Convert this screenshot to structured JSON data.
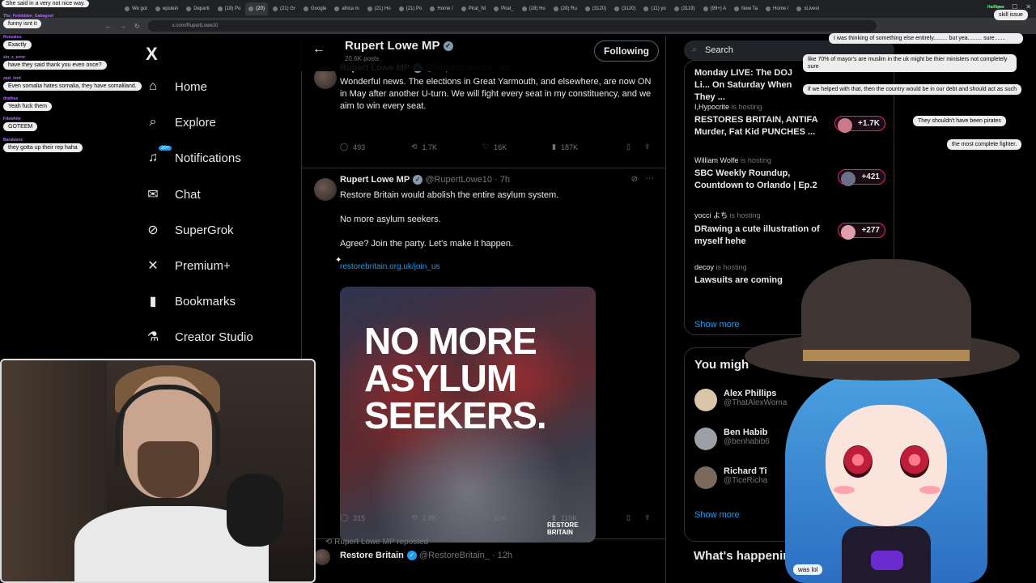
{
  "browser": {
    "tabs": [
      "We got",
      "epstein",
      "Departi",
      "(18) Po",
      "(20)",
      "(21) Gr",
      "Google",
      "africa m",
      "(21) Ho",
      "(21) Po",
      "Home /",
      "Pirat_Ni",
      "Pirat_",
      "(28) Ho",
      "(28) Ru",
      "(3120)",
      "(3120)",
      "(11) yo",
      "(3119)",
      "(99+) A",
      "New Ta",
      "Home /",
      "xLivest"
    ],
    "url": "x.com/RupertLowe10"
  },
  "nav": {
    "logo": "X",
    "items": [
      {
        "label": "Home",
        "icon": "home-icon"
      },
      {
        "label": "Explore",
        "icon": "search-icon"
      },
      {
        "label": "Notifications",
        "icon": "bell-icon",
        "badge": "20+"
      },
      {
        "label": "Chat",
        "icon": "mail-icon"
      },
      {
        "label": "SuperGrok",
        "icon": "grok-icon"
      },
      {
        "label": "Premium+",
        "icon": "x-icon"
      },
      {
        "label": "Bookmarks",
        "icon": "bookmark-icon"
      },
      {
        "label": "Creator Studio",
        "icon": "flask-icon"
      }
    ]
  },
  "profile": {
    "name": "Rupert Lowe MP",
    "posts": "20.6K posts",
    "follow_label": "Following"
  },
  "tweets": [
    {
      "name": "Rupert Lowe MP",
      "handle": "@RupertLowe10 · 5h",
      "text": "Wonderful news. The elections in Great Yarmouth, and elsewhere, are now ON in May after another U-turn. We will fight every seat in my constituency, and we aim to win every seat.",
      "replies": "493",
      "reposts": "1.7K",
      "likes": "16K",
      "views": "187K"
    },
    {
      "name": "Rupert Lowe MP",
      "handle": "@RupertLowe10 · 7h",
      "line1": "Restore Britain would abolish the entire asylum system.",
      "line2": "No more asylum seekers.",
      "line3": "Agree? Join the party. Let's make it happen.",
      "link": "restorebritain.org.uk/join_us",
      "media_text": "NO MORE ASYLUM SEEKERS.",
      "media_brand": "RESTORE BRITAIN",
      "replies": "315",
      "reposts": "1.8K",
      "likes": "10K",
      "views": "119K"
    }
  ],
  "repost": {
    "label": "Rupert Lowe MP reposted",
    "name": "Restore Britain",
    "handle": "@RestoreBritain_ · 12h"
  },
  "sidebar": {
    "search_placeholder": "Search",
    "top_item": "Monday LIVE: The DOJ Li... On Saturday When They ...",
    "spaces": [
      {
        "host": "I,Hypocrite",
        "meta": "is hosting",
        "title": "RESTORES BRITAIN, ANTIFA Murder, Fat Kid PUNCHES ...",
        "count": "+1.7K"
      },
      {
        "host": "William Wolfe",
        "meta": "is hosting",
        "title": "SBC Weekly Roundup, Countdown to Orlando | Ep.2",
        "count": "+421"
      },
      {
        "host": "yocci よち",
        "meta": "is hosting",
        "title": "DRawing a cute illustration of myself hehe",
        "count": "+277"
      },
      {
        "host": "decoy",
        "meta": "is hosting",
        "title": "Lawsuits are coming",
        "count": ""
      }
    ],
    "show_more": "Show more",
    "who_title": "You migh",
    "who": [
      {
        "name": "Alex Phillips",
        "handle": "@ThatAlexWoma"
      },
      {
        "name": "Ben Habib",
        "handle": "@benhabib6"
      },
      {
        "name": "Richard Ti",
        "handle": "@TiceRicha"
      }
    ],
    "happening_title": "What's happenin"
  },
  "chat_left": [
    {
      "user": "",
      "text": "She said in a very not nice way."
    },
    {
      "user": "The_Forbidden_Gabagool",
      "text": "funny isnt it"
    },
    {
      "user": "Ronzatsu",
      "text": "Exactly"
    },
    {
      "user": "sin_x_error",
      "text": "have they said thank you even once?"
    },
    {
      "user": "zaxl_lord",
      "text": "Even somalia hates somalia, they have somaliland."
    },
    {
      "user": "drathus",
      "text": "Yeah fuck them"
    },
    {
      "user": "Fdewhite",
      "text": "GOTEEM"
    },
    {
      "user": "Barabaree",
      "text": "they gotta up their rep haha"
    }
  ],
  "chat_right": [
    {
      "user": "Haiflipss",
      "text": "skill issue"
    },
    {
      "user": "",
      "text": "I was thinking of something else entirely......... but yea......... sure......."
    },
    {
      "user": "",
      "text": "like 70% of mayor's are muslim in the uk might be thier ministers not completely sure"
    },
    {
      "user": "",
      "text": "if we helped with that, then the country would be in our debt and should act as such"
    },
    {
      "user": "",
      "text": "They shouldn't have been pirates"
    },
    {
      "user": "",
      "text": "the most complete fighter."
    },
    {
      "user": "",
      "text": "was lol"
    }
  ]
}
